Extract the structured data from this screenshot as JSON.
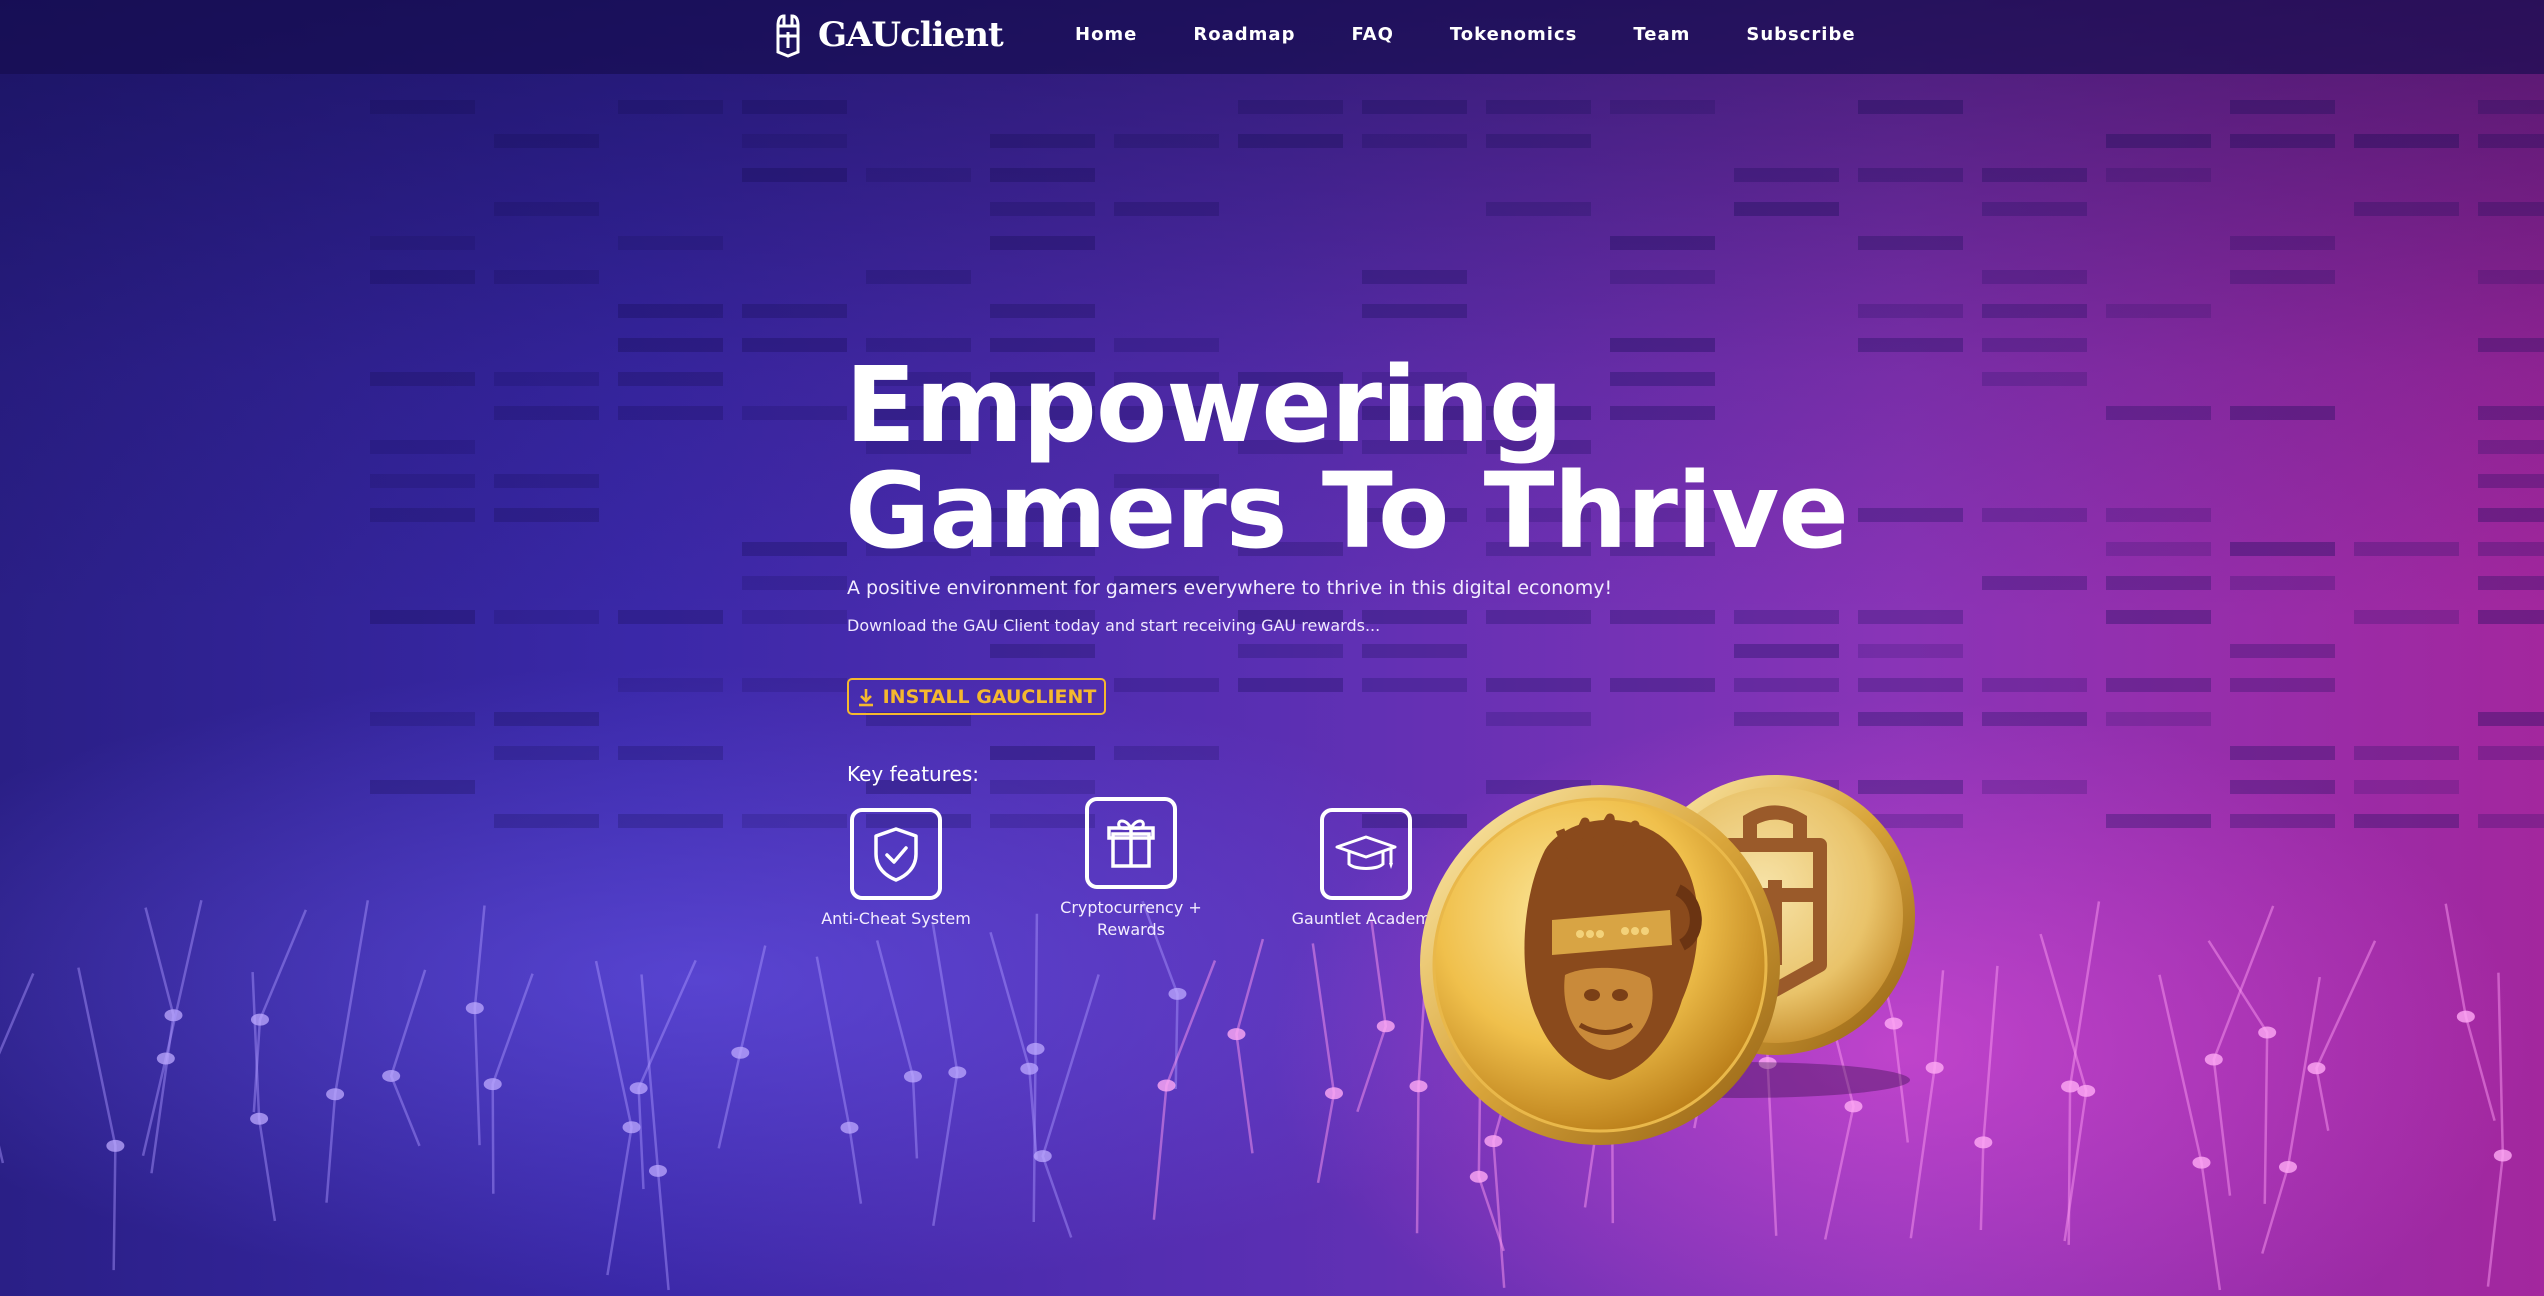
{
  "brand": {
    "name": "GAUclient",
    "logo_icon": "gau-logo-icon"
  },
  "nav": {
    "items": [
      {
        "label": "Home"
      },
      {
        "label": "Roadmap"
      },
      {
        "label": "FAQ"
      },
      {
        "label": "Tokenomics"
      },
      {
        "label": "Team"
      },
      {
        "label": "Subscribe"
      }
    ]
  },
  "hero": {
    "title_line1": "Empowering",
    "title_line2": "Gamers To Thrive",
    "subtitle": "A positive environment for gamers everywhere to thrive in this digital economy!",
    "subtitle2": "Download the GAU Client today and start receiving GAU rewards...",
    "install_button": {
      "label": "INSTALL GAUCLIENT",
      "icon": "download-icon"
    }
  },
  "features": {
    "heading": "Key features:",
    "items": [
      {
        "label": "Anti-Cheat System",
        "icon": "shield-check-icon"
      },
      {
        "label": "Cryptocurrency + Rewards",
        "icon": "gift-icon"
      },
      {
        "label": "Gauntlet Academy",
        "icon": "graduation-cap-icon"
      }
    ]
  },
  "coins": {
    "front_icon": "gorilla-coin-icon",
    "back_icon": "gau-logo-coin-icon"
  },
  "colors": {
    "accent": "#f5b82e",
    "background_left": "#2a1f86",
    "background_right": "#a3279e",
    "coin_gold": "#f0c04c",
    "coin_emboss": "#8a4a1c"
  }
}
